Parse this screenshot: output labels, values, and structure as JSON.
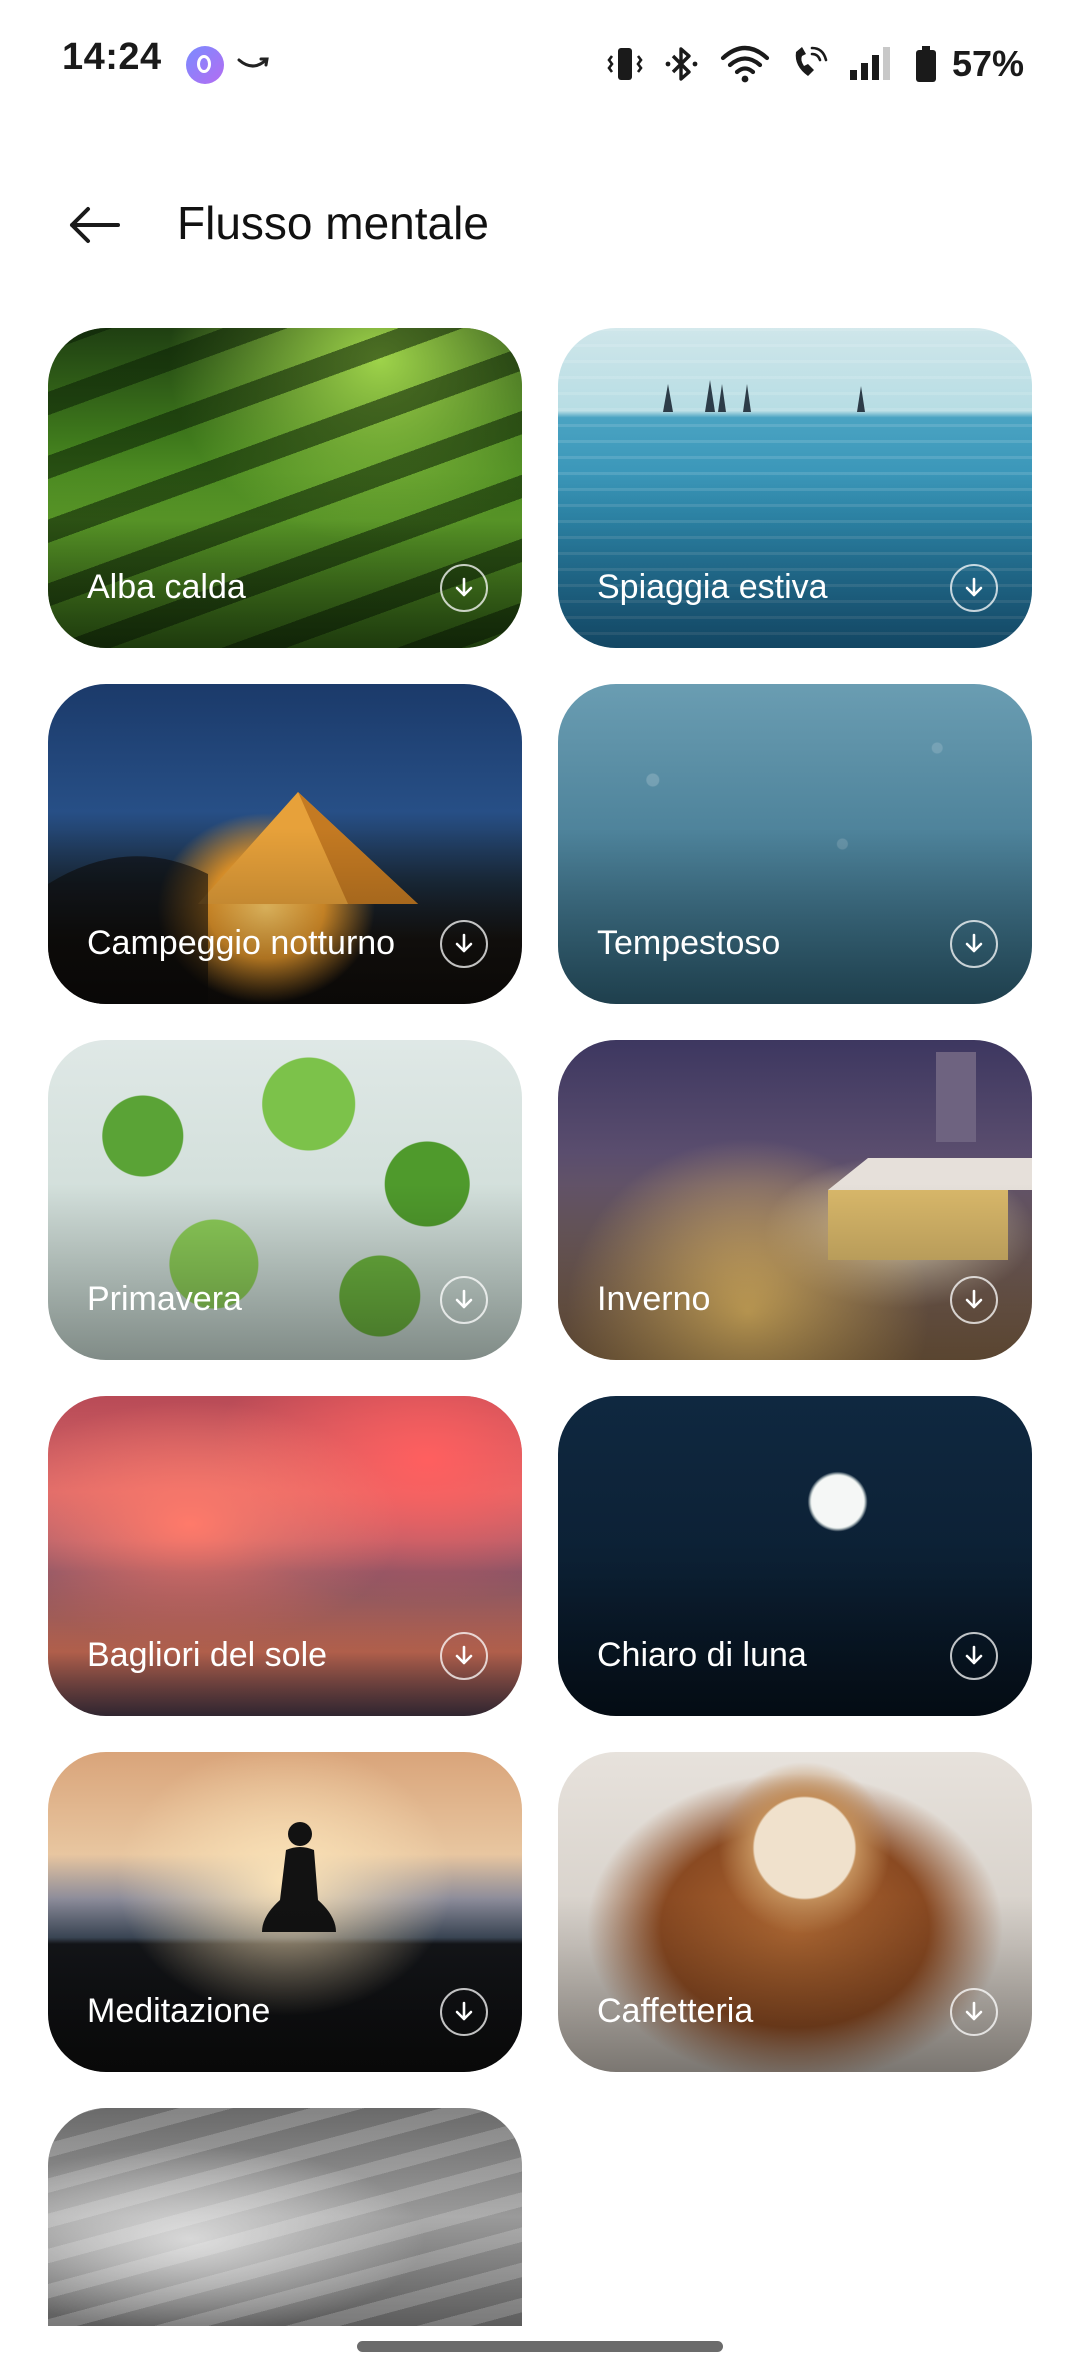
{
  "status_bar": {
    "time": "14:24",
    "battery_percent": "57%",
    "icons": [
      "vibrate-icon",
      "bluetooth-icon",
      "wifi-icon",
      "wifi-calling-icon",
      "signal-icon",
      "battery-icon"
    ],
    "notification_icons": [
      "assistant-app-icon",
      "amazon-icon"
    ]
  },
  "app_bar": {
    "title": "Flusso mentale",
    "back_icon": "arrow-left-icon"
  },
  "sounds": [
    {
      "label": "Alba calda",
      "image": "forest-sunlight"
    },
    {
      "label": "Spiaggia estiva",
      "image": "sea-sailboats"
    },
    {
      "label": "Campeggio notturno",
      "image": "tent-night"
    },
    {
      "label": "Tempestoso",
      "image": "rain-window"
    },
    {
      "label": "Primavera",
      "image": "spring-leaves"
    },
    {
      "label": "Inverno",
      "image": "winter-village"
    },
    {
      "label": "Bagliori del sole",
      "image": "sunset-clouds"
    },
    {
      "label": "Chiaro di luna",
      "image": "full-moon"
    },
    {
      "label": "Meditazione",
      "image": "meditation-silhouette"
    },
    {
      "label": "Caffetteria",
      "image": "cappuccino-cup"
    },
    {
      "label": "",
      "image": "grey-mist"
    }
  ],
  "card_action_icon": "download-icon",
  "colors": {
    "background": "#ffffff",
    "text": "#1a1a1a",
    "card_label": "#ffffff"
  }
}
